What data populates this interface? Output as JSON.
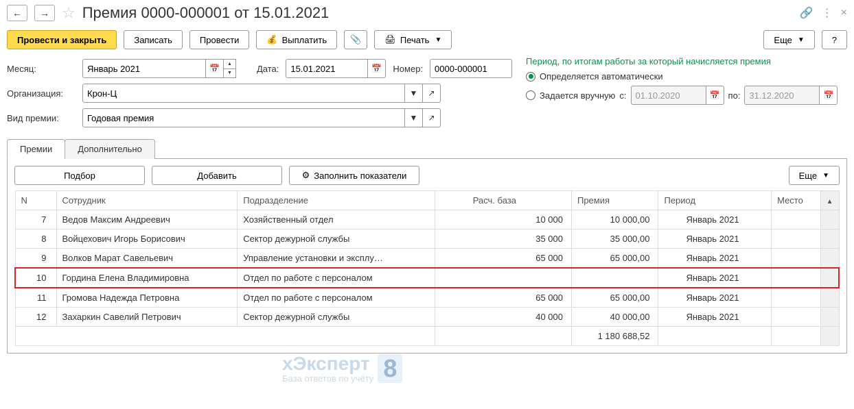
{
  "header": {
    "title": "Премия 0000-000001 от 15.01.2021"
  },
  "toolbar": {
    "main": "Провести и закрыть",
    "record": "Записать",
    "process": "Провести",
    "pay": "Выплатить",
    "print": "Печать",
    "more": "Еще",
    "help": "?"
  },
  "form": {
    "month_label": "Месяц:",
    "month_value": "Январь 2021",
    "org_label": "Организация:",
    "org_value": "Крон-Ц",
    "type_label": "Вид премии:",
    "type_value": "Годовая премия",
    "date_label": "Дата:",
    "date_value": "15.01.2021",
    "number_label": "Номер:",
    "number_value": "0000-000001"
  },
  "period": {
    "title": "Период, по итогам работы за который начисляется премия",
    "auto": "Определяется автоматически",
    "manual": "Задается вручную",
    "from_label": "с:",
    "from_value": "01.10.2020",
    "to_label": "по:",
    "to_value": "31.12.2020"
  },
  "tabs": {
    "premii": "Премии",
    "dop": "Дополнительно"
  },
  "tabToolbar": {
    "select": "Подбор",
    "add": "Добавить",
    "fill": "Заполнить показатели",
    "more": "Еще"
  },
  "columns": {
    "n": "N",
    "emp": "Сотрудник",
    "dep": "Подразделение",
    "base": "Расч. база",
    "prem": "Премия",
    "period": "Период",
    "place": "Место"
  },
  "rows": [
    {
      "n": "7",
      "emp": "Ведов Максим Андреевич",
      "dep": "Хозяйственный отдел",
      "base": "10 000",
      "prem": "10 000,00",
      "period": "Январь 2021"
    },
    {
      "n": "8",
      "emp": "Войцехович Игорь Борисович",
      "dep": "Сектор дежурной службы",
      "base": "35 000",
      "prem": "35 000,00",
      "period": "Январь 2021"
    },
    {
      "n": "9",
      "emp": "Волков Марат Савельевич",
      "dep": "Управление установки и эксплу…",
      "base": "65 000",
      "prem": "65 000,00",
      "period": "Январь 2021"
    },
    {
      "n": "10",
      "emp": "Гордина Елена Владимировна",
      "dep": "Отдел по работе с персоналом",
      "base": "",
      "prem": "",
      "period": "Январь 2021",
      "hl": true
    },
    {
      "n": "11",
      "emp": "Громова Надежда Петровна",
      "dep": "Отдел по работе с персоналом",
      "base": "65 000",
      "prem": "65 000,00",
      "period": "Январь 2021"
    },
    {
      "n": "12",
      "emp": "Захаркин Савелий Петрович",
      "dep": "Сектор дежурной службы",
      "base": "40 000",
      "prem": "40 000,00",
      "period": "Январь 2021"
    }
  ],
  "footer": {
    "total": "1 180 688,52"
  },
  "watermark": {
    "main": "хЭксперт",
    "sub": "База ответов по учёту",
    "badge": "8"
  }
}
